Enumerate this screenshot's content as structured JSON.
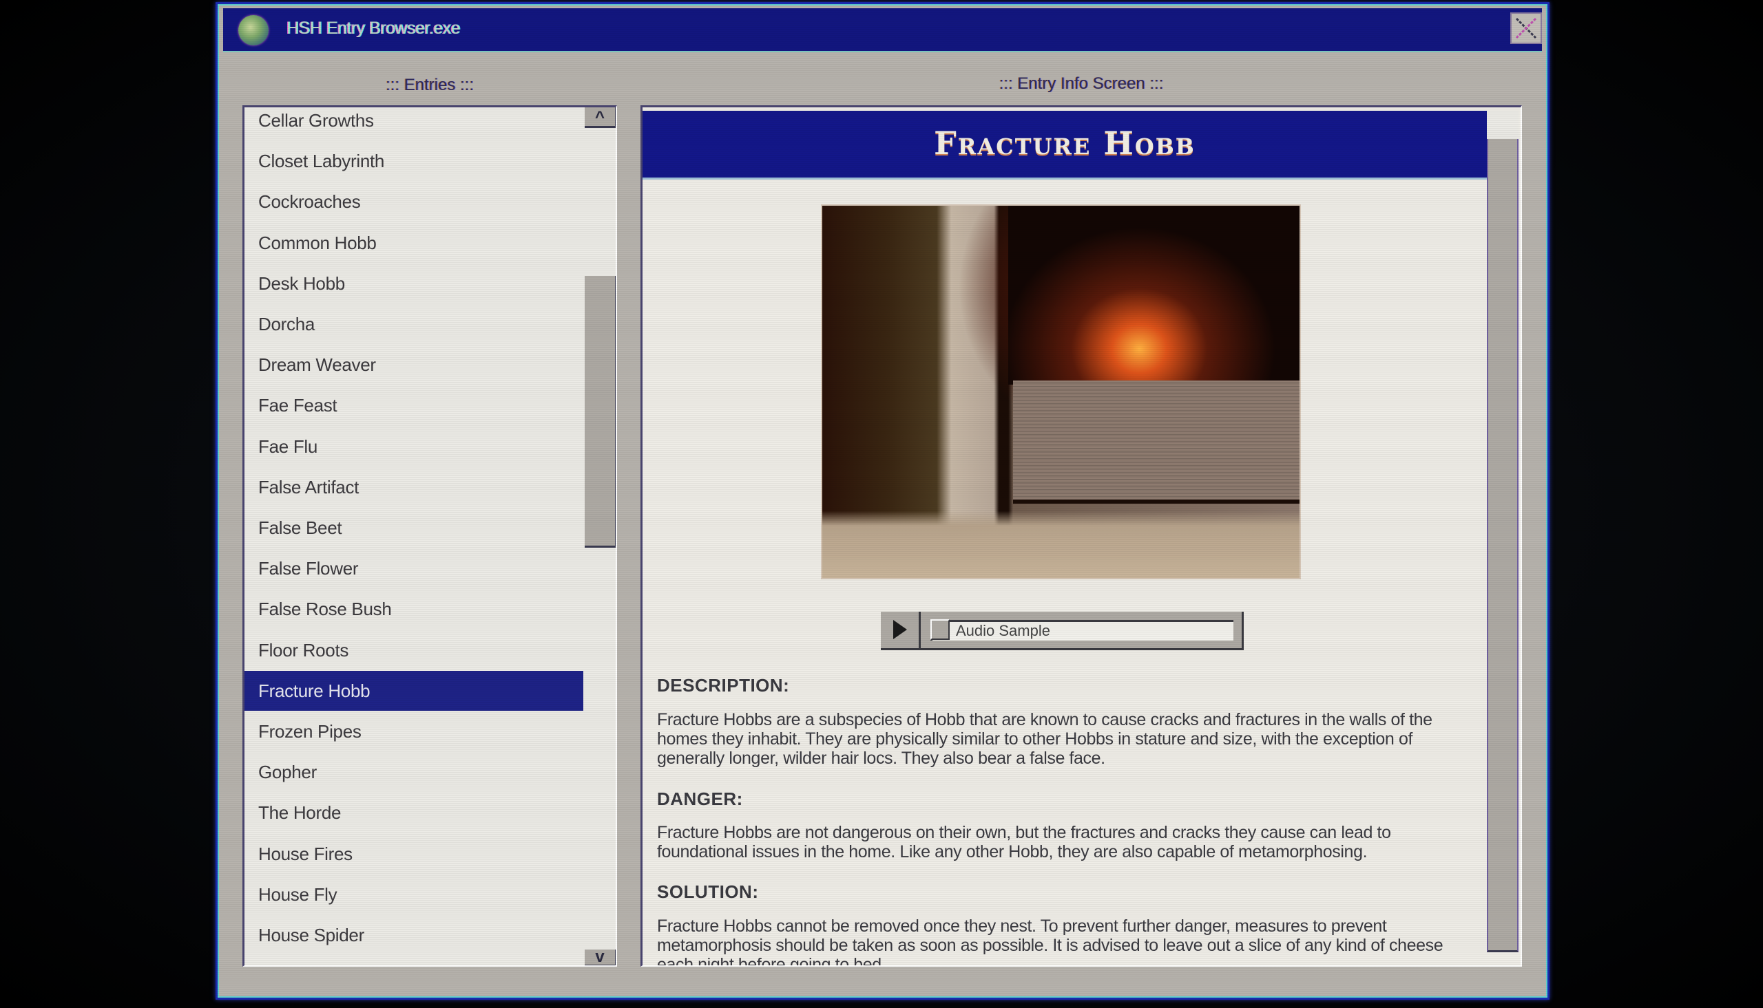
{
  "window": {
    "title": "HSH Entry Browser.exe",
    "app_icon": "globe-icon",
    "close_icon": "close-icon",
    "colors": {
      "titlebar": "#121680",
      "selection": "#1e2387",
      "chrome": "#b7b3ad"
    }
  },
  "entries_panel": {
    "label": "::: Entries :::",
    "scroll_up_glyph": "^",
    "scroll_down_glyph": "v",
    "selected": "Fracture Hobb",
    "items": [
      "Cellar Growths",
      "Closet Labyrinth",
      "Cockroaches",
      "Common Hobb",
      "Desk Hobb",
      "Dorcha",
      "Dream Weaver",
      "Fae Feast",
      "Fae Flu",
      "False Artifact",
      "False Beet",
      "False Flower",
      "False Rose Bush",
      "Floor Roots",
      "Fracture Hobb",
      "Frozen Pipes",
      "Gopher",
      "The Horde",
      "House Fires",
      "House Fly",
      "House Spider"
    ]
  },
  "info_panel": {
    "label": "::: Entry Info Screen :::",
    "title": "Fracture Hobb",
    "image_alt": "Creature peeking from behind a cracked fireplace wall",
    "audio": {
      "play_icon": "play-icon",
      "label": "Audio Sample"
    },
    "sections": [
      {
        "heading": "DESCRIPTION:",
        "body": "Fracture Hobbs are a subspecies of Hobb that are known to cause cracks and fractures in the walls of the homes they inhabit. They are physically similar to other Hobbs in stature and size, with the exception of generally longer, wilder hair locs. They also bear a false face."
      },
      {
        "heading": "DANGER:",
        "body": "Fracture Hobbs are not dangerous on their own, but the fractures and cracks they cause can lead to foundational issues in the home. Like any other Hobb, they are also capable of metamorphosing."
      },
      {
        "heading": "SOLUTION:",
        "body": "Fracture Hobbs cannot be removed once they nest. To prevent further danger, measures to prevent metamorphosis should be taken as soon as possible. It is advised to leave out a slice of any kind of cheese each night before going to bed."
      }
    ]
  }
}
